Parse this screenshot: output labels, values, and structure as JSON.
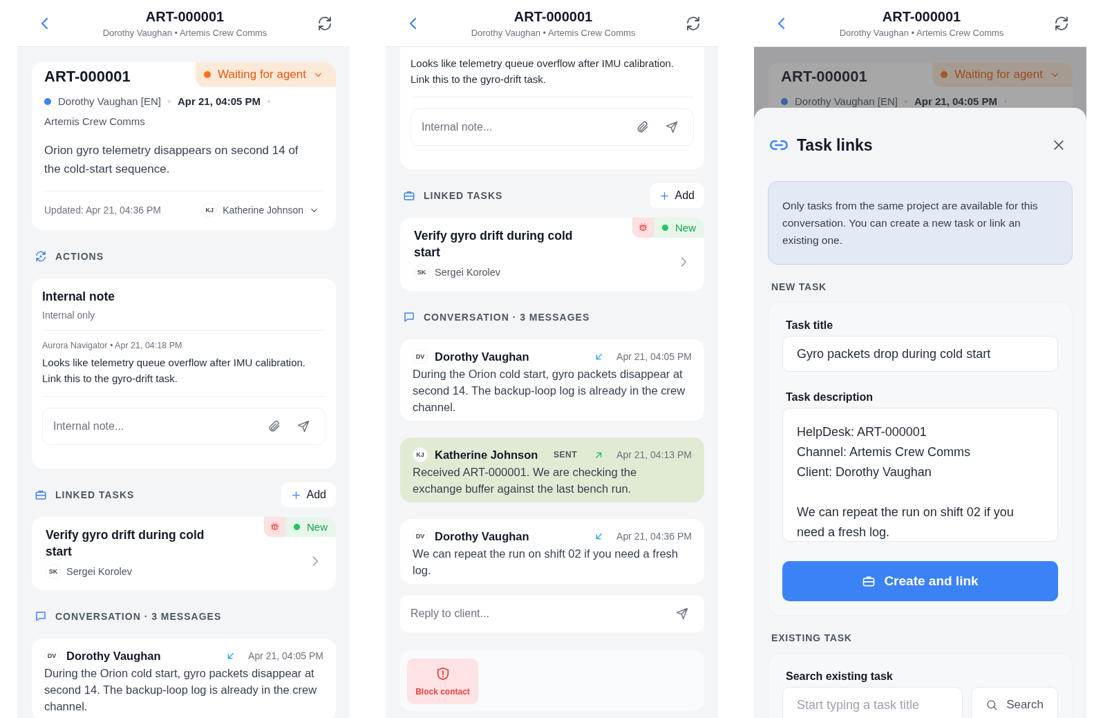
{
  "screens": [
    {
      "header": {
        "title": "ART-000001",
        "subtitle": "Dorothy Vaughan • Artemis Crew Comms"
      },
      "blocks": [
        {
          "kind": "ticket",
          "id": "ART-000001",
          "status": "Waiting for agent",
          "client": "Dorothy Vaughan [EN]",
          "created": "Apr 21, 04:05 PM",
          "channel": "Artemis Crew Comms",
          "description": "Orion gyro telemetry disappears on second 14 of the cold-start sequence.",
          "updated": "Updated: Apr 21, 04:36 PM",
          "assignee_initials": "KJ",
          "assignee": "Katherine Johnson"
        },
        {
          "kind": "actions_section",
          "label": "ACTIONS"
        },
        {
          "kind": "note_card",
          "title": "Internal note",
          "subtitle": "Internal only",
          "meta": "Aurora Navigator • Apr 21, 04:18 PM",
          "text": "Looks like telemetry queue overflow after IMU calibration. Link this to the gyro-drift task.",
          "placeholder": "Internal note..."
        },
        {
          "kind": "tasks_section",
          "label": "LINKED TASKS",
          "action": "Add"
        },
        {
          "kind": "task",
          "title": "Verify gyro drift during cold start",
          "status": "New",
          "assignee_initials": "SK",
          "assignee": "Sergei Korolev"
        },
        {
          "kind": "chat_section",
          "label": "CONVERSATION · 3 MESSAGES"
        },
        {
          "kind": "message_in",
          "initials": "DV",
          "author": "Dorothy Vaughan",
          "time": "Apr 21, 04:05 PM",
          "text": "During the Orion cold start, gyro packets disappear at second 14. The backup-loop log is already in the crew channel."
        }
      ]
    },
    {
      "header": {
        "title": "ART-000001",
        "subtitle": "Dorothy Vaughan • Artemis Crew Comms"
      },
      "blocks": [
        {
          "kind": "note_tail",
          "text": "Looks like telemetry queue overflow after IMU calibration. Link this to the gyro-drift task.",
          "placeholder": "Internal note..."
        },
        {
          "kind": "tasks_section",
          "label": "LINKED TASKS",
          "action": "Add"
        },
        {
          "kind": "task",
          "title": "Verify gyro drift during cold start",
          "status": "New",
          "assignee_initials": "SK",
          "assignee": "Sergei Korolev"
        },
        {
          "kind": "chat_section",
          "label": "CONVERSATION · 3 MESSAGES"
        },
        {
          "kind": "message_in",
          "initials": "DV",
          "author": "Dorothy Vaughan",
          "time": "Apr 21, 04:05 PM",
          "text": "During the Orion cold start, gyro packets disappear at second 14. The backup-loop log is already in the crew channel."
        },
        {
          "kind": "message_out",
          "initials": "KJ",
          "author": "Katherine Johnson",
          "sent_label": "SENT",
          "time": "Apr 21, 04:13 PM",
          "text": "Received ART-000001. We are checking the exchange buffer against the last bench run."
        },
        {
          "kind": "message_in",
          "initials": "DV",
          "author": "Dorothy Vaughan",
          "time": "Apr 21, 04:36 PM",
          "text": "We can repeat the run on shift 02 if you need a fresh log."
        },
        {
          "kind": "reply",
          "placeholder": "Reply to client..."
        },
        {
          "kind": "danger_actions",
          "items": [
            {
              "label": "Block contact"
            }
          ]
        }
      ]
    },
    {
      "header": {
        "title": "ART-000001",
        "subtitle": "Dorothy Vaughan • Artemis Crew Comms"
      },
      "blocks": [
        {
          "kind": "ticket_peek",
          "id": "ART-000001",
          "status": "Waiting for agent",
          "client": "Dorothy Vaughan [EN]",
          "created": "Apr 21, 04:05 PM"
        }
      ],
      "sheet": {
        "title": "Task links",
        "info": "Only tasks from the same project are available for this conversation. You can create a new task or link an existing one.",
        "new_task": {
          "heading": "NEW TASK",
          "title_label": "Task title",
          "title_value": "Gyro packets drop during cold start",
          "desc_label": "Task description",
          "desc_value": "HelpDesk: ART-000001\nChannel: Artemis Crew Comms\nClient: Dorothy Vaughan\n\nWe can repeat the run on shift 02 if you need a fresh log.",
          "button": "Create and link"
        },
        "existing": {
          "heading": "EXISTING TASK",
          "search_label": "Search existing task",
          "placeholder": "Start typing a task title",
          "button": "Search"
        }
      }
    }
  ]
}
